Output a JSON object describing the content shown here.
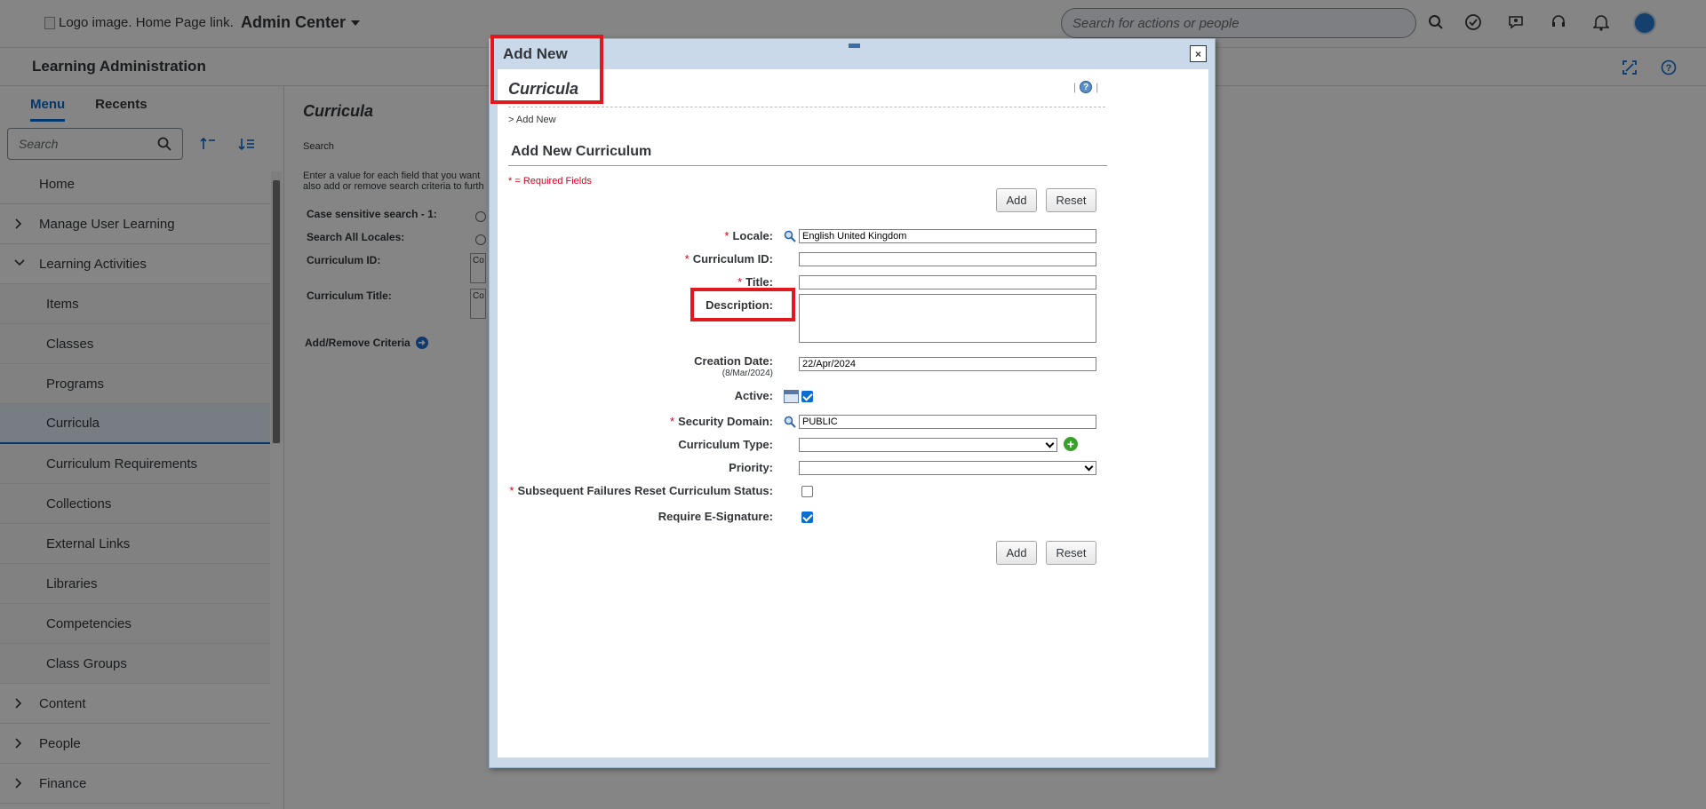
{
  "shell": {
    "logo_alt": "Logo image. Home Page link.",
    "app_title": "Admin Center",
    "search_placeholder": "Search for actions or people"
  },
  "subheader": {
    "title": "Learning Administration"
  },
  "nav": {
    "tabs": [
      "Menu",
      "Recents"
    ],
    "search_placeholder": "Search",
    "items": [
      {
        "label": "Home",
        "type": "top"
      },
      {
        "label": "Manage User Learning",
        "type": "top",
        "chevron": "right"
      },
      {
        "label": "Learning Activities",
        "type": "top",
        "chevron": "down"
      },
      {
        "label": "Items",
        "type": "sub"
      },
      {
        "label": "Classes",
        "type": "sub"
      },
      {
        "label": "Programs",
        "type": "sub"
      },
      {
        "label": "Curricula",
        "type": "sub",
        "selected": true
      },
      {
        "label": "Curriculum Requirements",
        "type": "sub"
      },
      {
        "label": "Collections",
        "type": "sub"
      },
      {
        "label": "External Links",
        "type": "sub"
      },
      {
        "label": "Libraries",
        "type": "sub"
      },
      {
        "label": "Competencies",
        "type": "sub"
      },
      {
        "label": "Class Groups",
        "type": "sub"
      },
      {
        "label": "Content",
        "type": "top",
        "chevron": "right"
      },
      {
        "label": "People",
        "type": "top",
        "chevron": "right"
      },
      {
        "label": "Finance",
        "type": "top",
        "chevron": "right"
      }
    ]
  },
  "main": {
    "title": "Curricula",
    "search_label": "Search",
    "intro_line1": "Enter a value for each field that you want",
    "intro_line2": "also add or remove search criteria to furth",
    "criteria": {
      "case_sensitive": "Case sensitive search - 1:",
      "all_locales": "Search All Locales:",
      "curriculum_id": "Curriculum ID:",
      "curriculum_title": "Curriculum Title:",
      "box_text": "Co"
    },
    "add_remove": "Add/Remove Criteria"
  },
  "dialog": {
    "title": "Add New",
    "close_glyph": "×",
    "heading": "Curricula",
    "breadcrumb": "> Add New",
    "section_title": "Add New Curriculum",
    "required_note": "* = Required Fields",
    "buttons": {
      "add": "Add",
      "reset": "Reset"
    },
    "fields": {
      "locale": {
        "label": "Locale:",
        "value": "English United Kingdom"
      },
      "curriculum_id": {
        "label": "Curriculum ID:",
        "value": ""
      },
      "title": {
        "label": "Title:",
        "value": ""
      },
      "description": {
        "label": "Description:"
      },
      "creation_date": {
        "label": "Creation Date:",
        "hint": "(8/Mar/2024)",
        "value": "22/Apr/2024"
      },
      "active": {
        "label": "Active:",
        "checked": true
      },
      "security_domain": {
        "label": "Security Domain:",
        "value": "PUBLIC"
      },
      "curriculum_type": {
        "label": "Curriculum Type:",
        "value": ""
      },
      "priority": {
        "label": "Priority:",
        "value": ""
      },
      "subsequent_failures": {
        "label": "Subsequent Failures Reset Curriculum Status:",
        "checked": false
      },
      "require_esig": {
        "label": "Require E-Signature:",
        "checked": true
      }
    }
  },
  "colors": {
    "highlight": "#e0191f",
    "accent": "#0a6ed1",
    "required": "#d0021b"
  }
}
